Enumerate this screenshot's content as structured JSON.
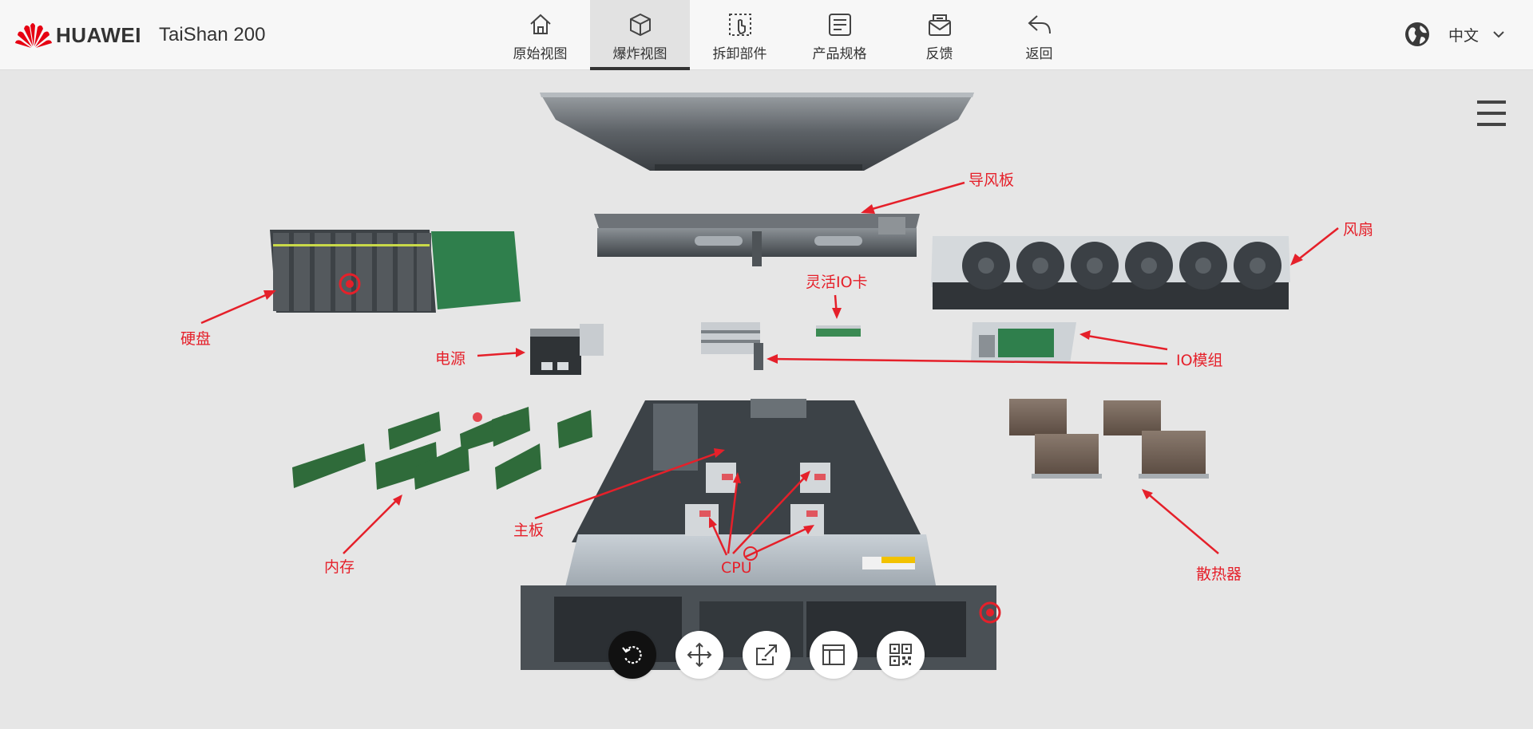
{
  "header": {
    "brand": "HUAWEI",
    "product": "TaiShan 200"
  },
  "nav": [
    {
      "label": "原始视图",
      "icon": "home-icon"
    },
    {
      "label": "爆炸视图",
      "icon": "cube-icon",
      "active": true
    },
    {
      "label": "拆卸部件",
      "icon": "hand-touch-icon"
    },
    {
      "label": "产品规格",
      "icon": "spec-sheet-icon"
    },
    {
      "label": "反馈",
      "icon": "feedback-mail-icon"
    },
    {
      "label": "返回",
      "icon": "back-arrow-icon"
    }
  ],
  "language": {
    "label": "中文"
  },
  "callouts": {
    "air_duct": "导风板",
    "fan": "风扇",
    "flex_io": "灵活IO卡",
    "disk": "硬盘",
    "psu": "电源",
    "io_module": "IO模组",
    "board": "主板",
    "memory": "内存",
    "cpu": "CPU",
    "heatsink": "散热器"
  },
  "toolbar": [
    "reset-rotate-icon",
    "move-icon",
    "external-link-icon",
    "layout-icon",
    "qr-code-icon"
  ],
  "colors": {
    "accent": "#e5202a",
    "huawei_red": "#e60012"
  }
}
